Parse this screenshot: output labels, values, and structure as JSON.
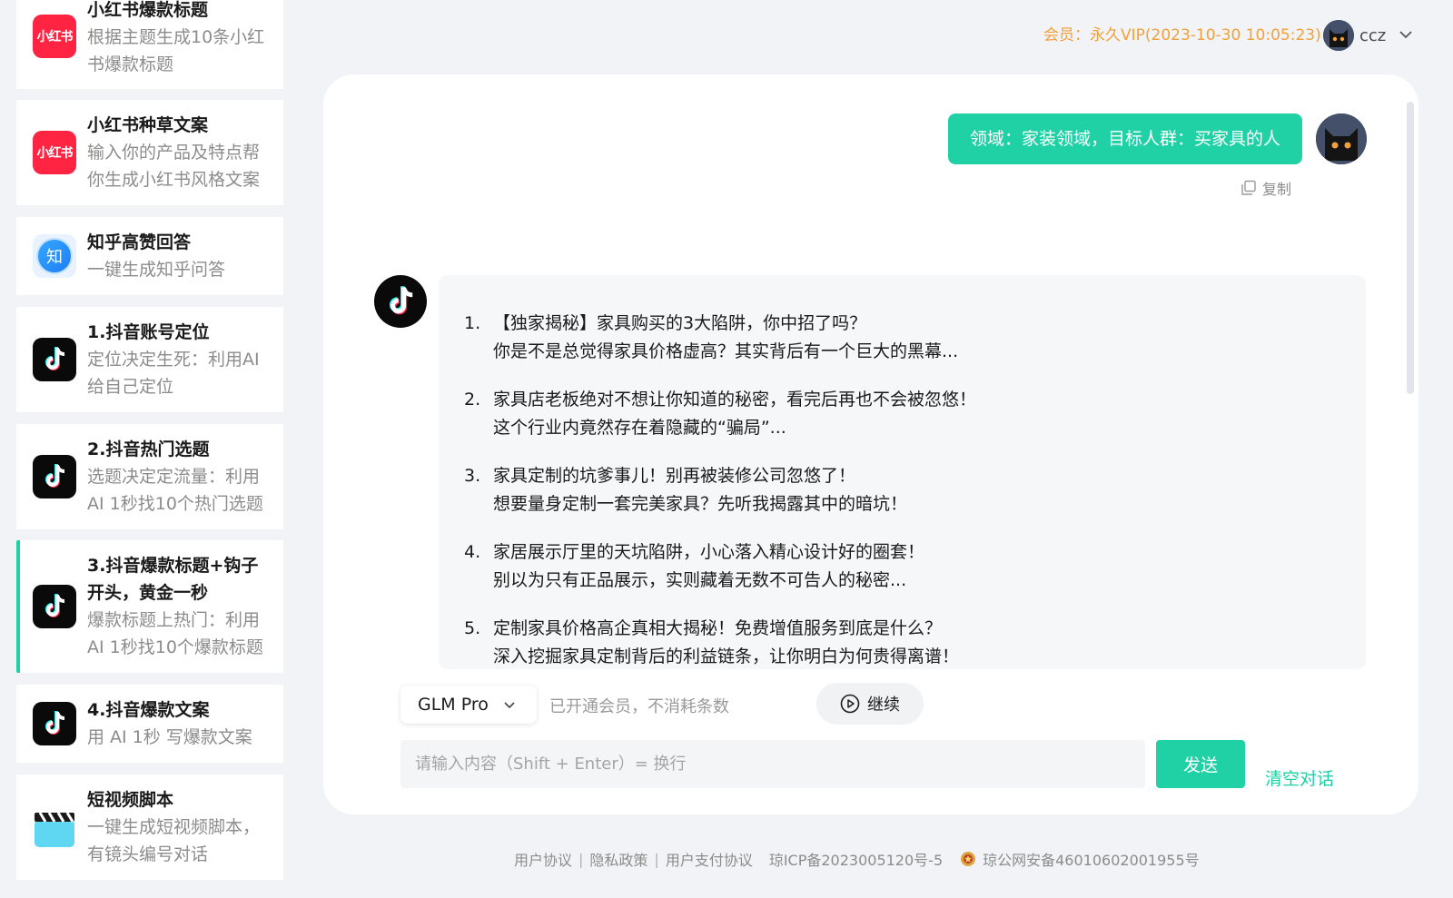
{
  "sidebar": {
    "items": [
      {
        "title": "小红书爆款标题",
        "desc": "根据主题生成10条小红书爆款标题",
        "icon": "xiaohongshu-icon",
        "icon_text": "小红书"
      },
      {
        "title": "小红书种草文案",
        "desc": "输入你的产品及特点帮你生成小红书风格文案",
        "icon": "xiaohongshu-icon",
        "icon_text": "小红书"
      },
      {
        "title": "知乎高赞回答",
        "desc": "一键生成知乎问答",
        "icon": "zhihu-icon",
        "icon_text": "知"
      },
      {
        "title": "1.抖音账号定位",
        "desc": "定位决定生死：利用AI给自己定位",
        "icon": "tiktok-icon"
      },
      {
        "title": "2.抖音热门选题",
        "desc": "选题决定定流量：利用AI 1秒找10个热门选题",
        "icon": "tiktok-icon"
      },
      {
        "title": "3.抖音爆款标题+钩子开头，黄金一秒",
        "desc": "爆款标题上热门：利用AI 1秒找10个爆款标题",
        "icon": "tiktok-icon",
        "active": true
      },
      {
        "title": "4.抖音爆款文案",
        "desc": "用 AI 1秒 写爆款文案",
        "icon": "tiktok-icon"
      },
      {
        "title": "短视频脚本",
        "desc": "一键生成短视频脚本，有镜头编号对话",
        "icon": "clapperboard-icon"
      }
    ]
  },
  "header": {
    "vip_status": "会员：永久VIP(2023-10-30 10:05:23)",
    "username": "ccz"
  },
  "chat": {
    "user_message": "领域：家装领域，目标人群：买家具的人",
    "copy_label": "复制",
    "answers": [
      {
        "num": "1.",
        "line1": "【独家揭秘】家具购买的3大陷阱，你中招了吗？",
        "line2": "你是不是总觉得家具价格虚高？其实背后有一个巨大的黑幕..."
      },
      {
        "num": "2.",
        "line1": "家具店老板绝对不想让你知道的秘密，看完后再也不会被忽悠！",
        "line2": "这个行业内竟然存在着隐藏的“骗局”..."
      },
      {
        "num": "3.",
        "line1": "家具定制的坑爹事儿！别再被装修公司忽悠了！",
        "line2": "想要量身定制一套完美家具？先听我揭露其中的暗坑！"
      },
      {
        "num": "4.",
        "line1": "家居展示厅里的天坑陷阱，小心落入精心设计好的圈套！",
        "line2": "别以为只有正品展示，实则藏着无数不可告人的秘密..."
      },
      {
        "num": "5.",
        "line1": "定制家具价格高企真相大揭秘！免费增值服务到底是什么？",
        "line2": "深入挖掘家具定制背后的利益链条，让你明白为何贵得离谱！"
      }
    ]
  },
  "input": {
    "model": "GLM Pro",
    "member_note": "已开通会员，不消耗条数",
    "continue_label": "继续",
    "placeholder": "请输入内容（Shift + Enter）= 换行",
    "value": "",
    "send_label": "发送",
    "clear_label": "清空对话"
  },
  "footer": {
    "user_agreement": "用户协议",
    "privacy": "隐私政策",
    "payment_agreement": "用户支付协议",
    "icp": "琼ICP备2023005120号-5",
    "police": "琼公网安备46010602001955号"
  },
  "colors": {
    "accent": "#1fd1a4",
    "vip": "#f2a13a",
    "xiaohongshu": "#ff2442"
  }
}
